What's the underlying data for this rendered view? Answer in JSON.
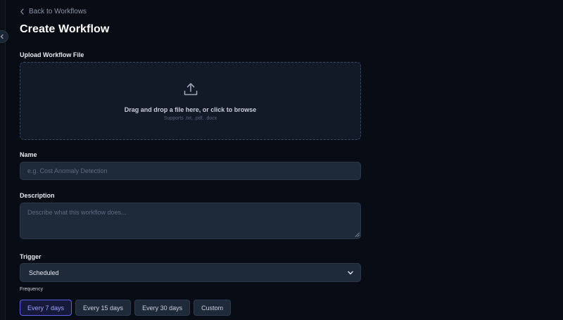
{
  "nav": {
    "back_label": "Back to Workflows"
  },
  "page": {
    "title": "Create Workflow"
  },
  "upload": {
    "label": "Upload Workflow File",
    "title": "Drag and drop a file here, or click to browse",
    "supported": "Supports .txt, .pdf, .docx",
    "icon": "upload-icon"
  },
  "name": {
    "label": "Name",
    "placeholder": "e.g. Cost Anomaly Detection",
    "value": ""
  },
  "description": {
    "label": "Description",
    "placeholder": "Describe what this workflow does...",
    "value": ""
  },
  "trigger": {
    "label": "Trigger",
    "selected": "Scheduled"
  },
  "frequency": {
    "label": "Frequency",
    "options": [
      "Every 7 days",
      "Every 15 days",
      "Every 30 days",
      "Custom"
    ],
    "selected_index": 0
  },
  "colors": {
    "background": "#080c14",
    "panel": "#121a27",
    "input": "#1e293a",
    "accent": "#5a5ef0",
    "accent_text": "#9ea4ff"
  }
}
